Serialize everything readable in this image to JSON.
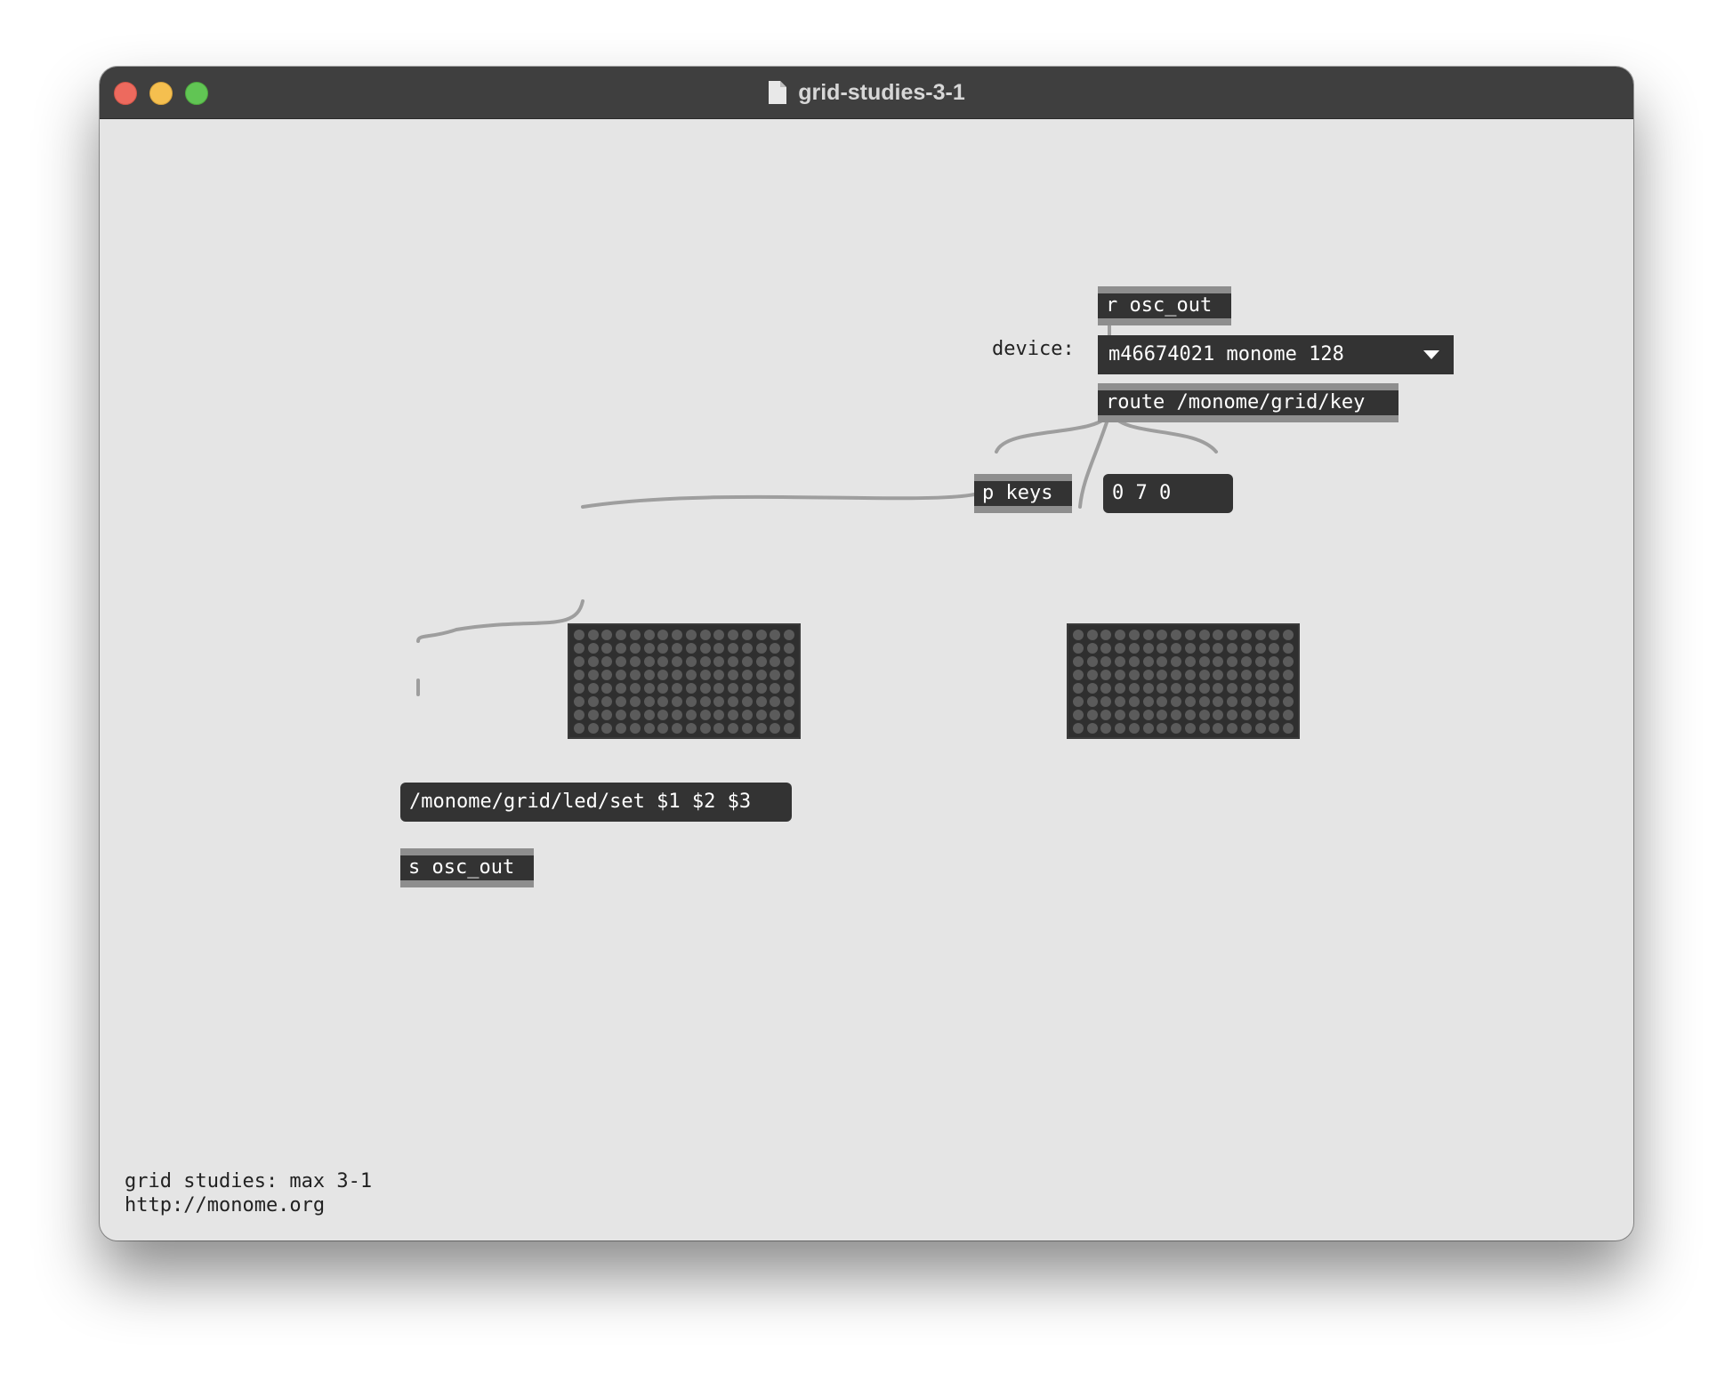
{
  "window": {
    "title": "grid-studies-3-1"
  },
  "patch": {
    "receive_object": "r osc_out",
    "device_label": "device:",
    "device_menu_value": "m46674021 monome 128",
    "route_object": "route /monome/grid/key",
    "keys_object": "p keys",
    "number_message": "0 7 0",
    "led_message": "/monome/grid/led/set $1 $2 $3",
    "send_object": "s osc_out",
    "grid_columns": 16,
    "grid_rows": 8
  },
  "comments": {
    "line1": "grid studies: max 3-1",
    "line2": "http://monome.org"
  },
  "colors": {
    "titlebar": "#3f3f3f",
    "canvas": "#e5e5e5",
    "object_fill": "#333333",
    "cord": "#a0a0a0"
  }
}
